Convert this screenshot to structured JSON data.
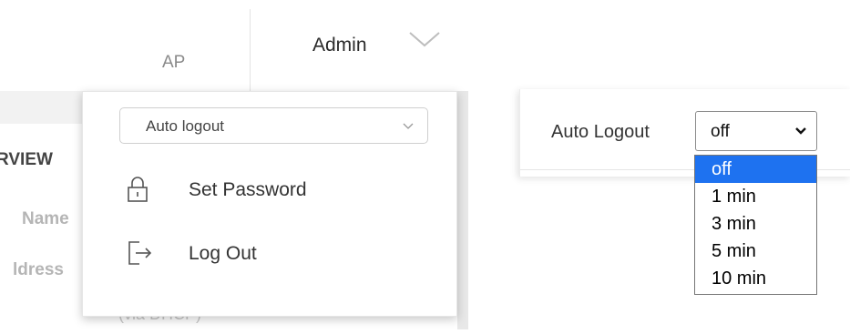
{
  "nav": {
    "ap_label": "AP",
    "admin_label": "Admin"
  },
  "background": {
    "overview": "RVIEW",
    "name": "Name",
    "address": "ldress",
    "dhcp": "(via DHCP)"
  },
  "menu": {
    "auto_logout_select": "Auto logout",
    "items": [
      {
        "label": "Set Password",
        "icon": "lock-icon"
      },
      {
        "label": "Log Out",
        "icon": "logout-icon"
      }
    ]
  },
  "auto_logout_panel": {
    "label": "Auto Logout",
    "selected": "off",
    "options": [
      "off",
      "1 min",
      "3 min",
      "5 min",
      "10 min"
    ]
  },
  "colors": {
    "selected_option": "#1e72f0"
  }
}
